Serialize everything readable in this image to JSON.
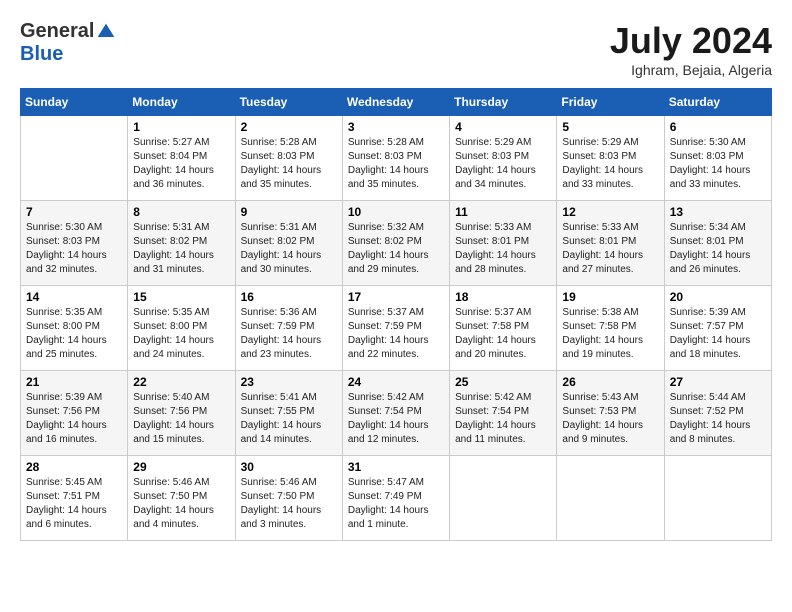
{
  "header": {
    "logo_general": "General",
    "logo_blue": "Blue",
    "month_title": "July 2024",
    "location": "Ighram, Bejaia, Algeria"
  },
  "days_of_week": [
    "Sunday",
    "Monday",
    "Tuesday",
    "Wednesday",
    "Thursday",
    "Friday",
    "Saturday"
  ],
  "weeks": [
    [
      {
        "day": "",
        "info": ""
      },
      {
        "day": "1",
        "info": "Sunrise: 5:27 AM\nSunset: 8:04 PM\nDaylight: 14 hours\nand 36 minutes."
      },
      {
        "day": "2",
        "info": "Sunrise: 5:28 AM\nSunset: 8:03 PM\nDaylight: 14 hours\nand 35 minutes."
      },
      {
        "day": "3",
        "info": "Sunrise: 5:28 AM\nSunset: 8:03 PM\nDaylight: 14 hours\nand 35 minutes."
      },
      {
        "day": "4",
        "info": "Sunrise: 5:29 AM\nSunset: 8:03 PM\nDaylight: 14 hours\nand 34 minutes."
      },
      {
        "day": "5",
        "info": "Sunrise: 5:29 AM\nSunset: 8:03 PM\nDaylight: 14 hours\nand 33 minutes."
      },
      {
        "day": "6",
        "info": "Sunrise: 5:30 AM\nSunset: 8:03 PM\nDaylight: 14 hours\nand 33 minutes."
      }
    ],
    [
      {
        "day": "7",
        "info": "Sunrise: 5:30 AM\nSunset: 8:03 PM\nDaylight: 14 hours\nand 32 minutes."
      },
      {
        "day": "8",
        "info": "Sunrise: 5:31 AM\nSunset: 8:02 PM\nDaylight: 14 hours\nand 31 minutes."
      },
      {
        "day": "9",
        "info": "Sunrise: 5:31 AM\nSunset: 8:02 PM\nDaylight: 14 hours\nand 30 minutes."
      },
      {
        "day": "10",
        "info": "Sunrise: 5:32 AM\nSunset: 8:02 PM\nDaylight: 14 hours\nand 29 minutes."
      },
      {
        "day": "11",
        "info": "Sunrise: 5:33 AM\nSunset: 8:01 PM\nDaylight: 14 hours\nand 28 minutes."
      },
      {
        "day": "12",
        "info": "Sunrise: 5:33 AM\nSunset: 8:01 PM\nDaylight: 14 hours\nand 27 minutes."
      },
      {
        "day": "13",
        "info": "Sunrise: 5:34 AM\nSunset: 8:01 PM\nDaylight: 14 hours\nand 26 minutes."
      }
    ],
    [
      {
        "day": "14",
        "info": "Sunrise: 5:35 AM\nSunset: 8:00 PM\nDaylight: 14 hours\nand 25 minutes."
      },
      {
        "day": "15",
        "info": "Sunrise: 5:35 AM\nSunset: 8:00 PM\nDaylight: 14 hours\nand 24 minutes."
      },
      {
        "day": "16",
        "info": "Sunrise: 5:36 AM\nSunset: 7:59 PM\nDaylight: 14 hours\nand 23 minutes."
      },
      {
        "day": "17",
        "info": "Sunrise: 5:37 AM\nSunset: 7:59 PM\nDaylight: 14 hours\nand 22 minutes."
      },
      {
        "day": "18",
        "info": "Sunrise: 5:37 AM\nSunset: 7:58 PM\nDaylight: 14 hours\nand 20 minutes."
      },
      {
        "day": "19",
        "info": "Sunrise: 5:38 AM\nSunset: 7:58 PM\nDaylight: 14 hours\nand 19 minutes."
      },
      {
        "day": "20",
        "info": "Sunrise: 5:39 AM\nSunset: 7:57 PM\nDaylight: 14 hours\nand 18 minutes."
      }
    ],
    [
      {
        "day": "21",
        "info": "Sunrise: 5:39 AM\nSunset: 7:56 PM\nDaylight: 14 hours\nand 16 minutes."
      },
      {
        "day": "22",
        "info": "Sunrise: 5:40 AM\nSunset: 7:56 PM\nDaylight: 14 hours\nand 15 minutes."
      },
      {
        "day": "23",
        "info": "Sunrise: 5:41 AM\nSunset: 7:55 PM\nDaylight: 14 hours\nand 14 minutes."
      },
      {
        "day": "24",
        "info": "Sunrise: 5:42 AM\nSunset: 7:54 PM\nDaylight: 14 hours\nand 12 minutes."
      },
      {
        "day": "25",
        "info": "Sunrise: 5:42 AM\nSunset: 7:54 PM\nDaylight: 14 hours\nand 11 minutes."
      },
      {
        "day": "26",
        "info": "Sunrise: 5:43 AM\nSunset: 7:53 PM\nDaylight: 14 hours\nand 9 minutes."
      },
      {
        "day": "27",
        "info": "Sunrise: 5:44 AM\nSunset: 7:52 PM\nDaylight: 14 hours\nand 8 minutes."
      }
    ],
    [
      {
        "day": "28",
        "info": "Sunrise: 5:45 AM\nSunset: 7:51 PM\nDaylight: 14 hours\nand 6 minutes."
      },
      {
        "day": "29",
        "info": "Sunrise: 5:46 AM\nSunset: 7:50 PM\nDaylight: 14 hours\nand 4 minutes."
      },
      {
        "day": "30",
        "info": "Sunrise: 5:46 AM\nSunset: 7:50 PM\nDaylight: 14 hours\nand 3 minutes."
      },
      {
        "day": "31",
        "info": "Sunrise: 5:47 AM\nSunset: 7:49 PM\nDaylight: 14 hours\nand 1 minute."
      },
      {
        "day": "",
        "info": ""
      },
      {
        "day": "",
        "info": ""
      },
      {
        "day": "",
        "info": ""
      }
    ]
  ]
}
